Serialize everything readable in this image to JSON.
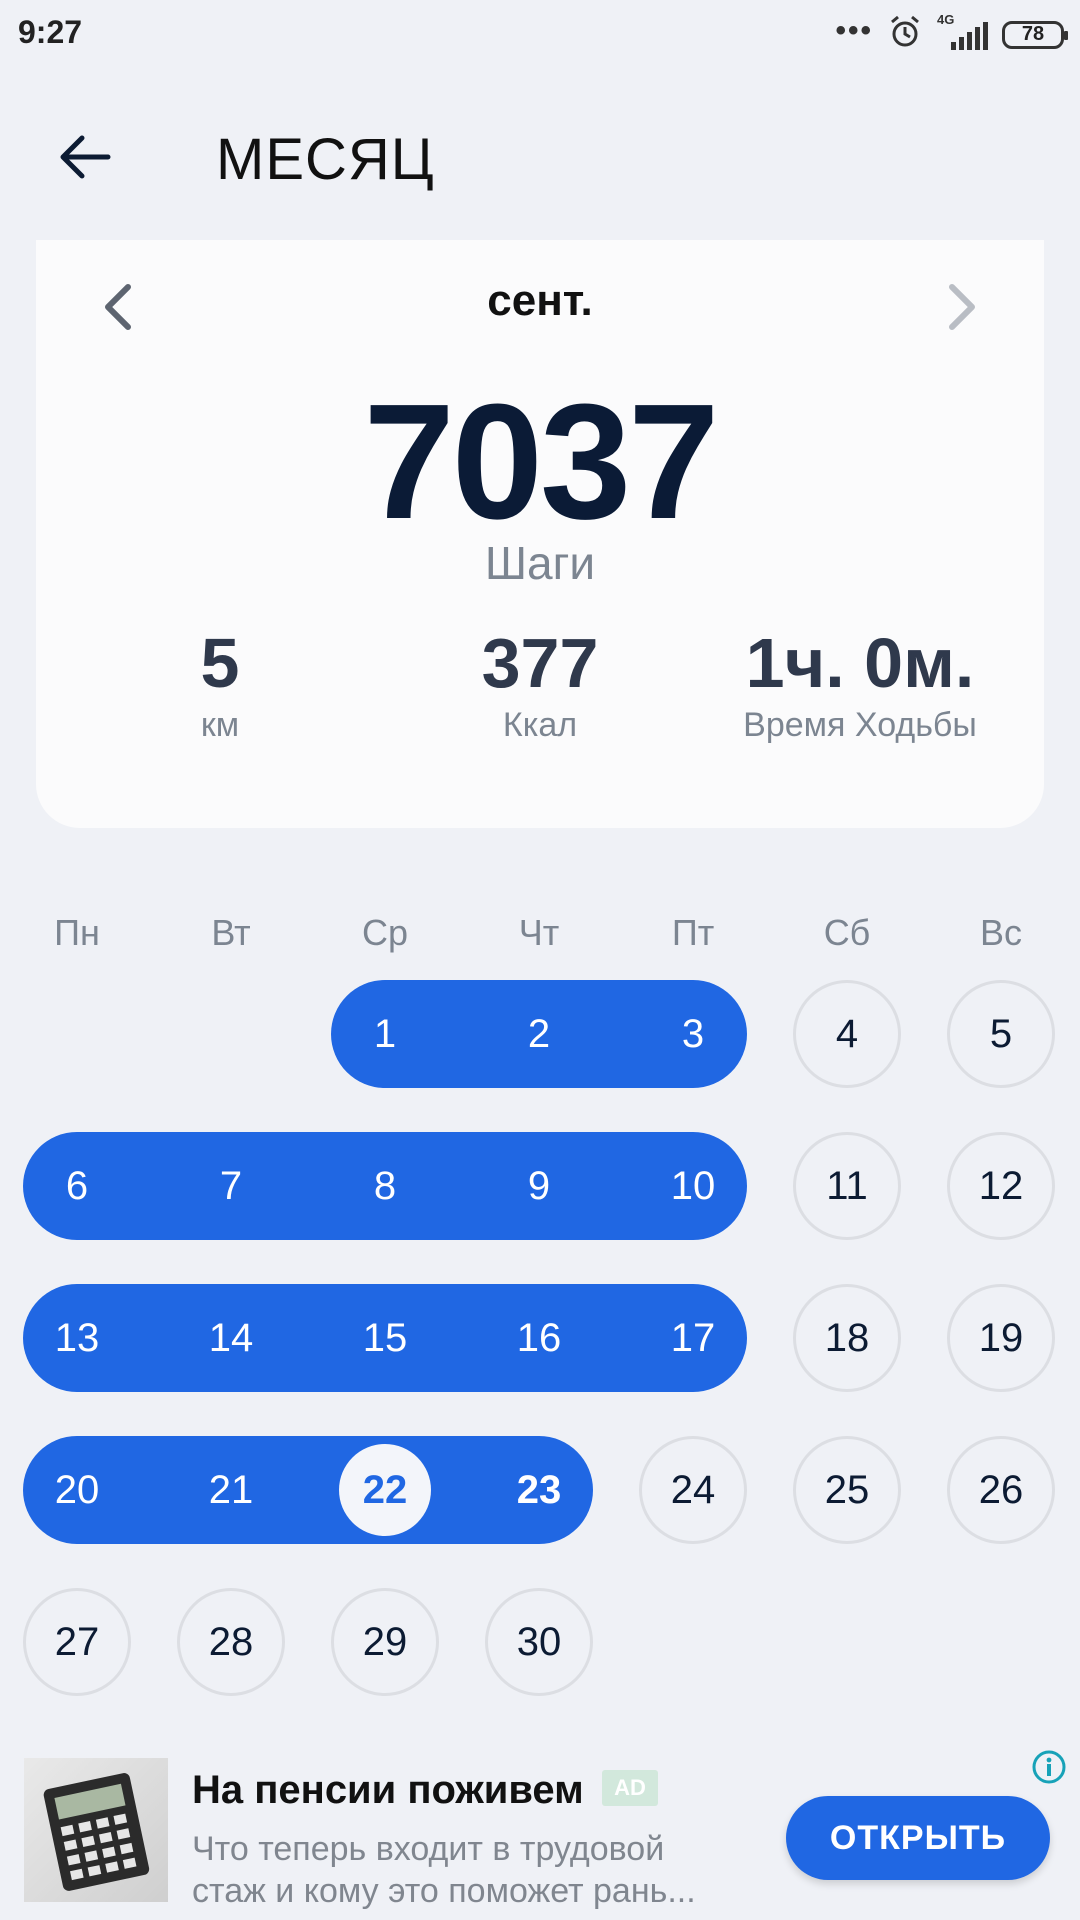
{
  "status_bar": {
    "time": "9:27",
    "network": "4G",
    "battery": "78"
  },
  "header": {
    "title": "МЕСЯЦ"
  },
  "summary": {
    "month": "сент.",
    "steps": "7037",
    "steps_label": "Шаги",
    "stats": [
      {
        "value": "5",
        "label": "км"
      },
      {
        "value": "377",
        "label": "Ккал"
      },
      {
        "value": "1ч. 0м.",
        "label": "Время Ходьбы"
      }
    ]
  },
  "calendar": {
    "weekdays": [
      "Пн",
      "Вт",
      "Ср",
      "Чт",
      "Пт",
      "Сб",
      "Вс"
    ],
    "first_weekday_index": 2,
    "days_in_month": 30,
    "today": 22,
    "goal_met_days": [
      1,
      2,
      3,
      6,
      7,
      8,
      9,
      10,
      13,
      14,
      15,
      16,
      17,
      20,
      21,
      22,
      23
    ]
  },
  "ad": {
    "title": "На пенсии поживем",
    "badge": "AD",
    "text_line1": "Что теперь входит в трудовой",
    "text_line2": "стаж и кому это поможет рань...",
    "cta": "ОТКРЫТЬ"
  },
  "colors": {
    "accent": "#2067e3",
    "background": "#eff1f6",
    "card": "#fbfbfc"
  }
}
